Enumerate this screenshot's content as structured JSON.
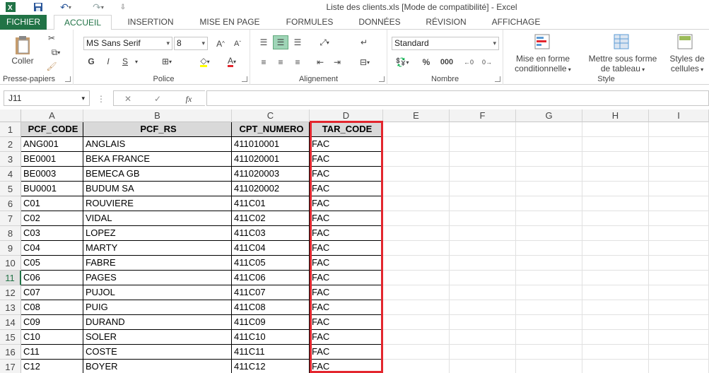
{
  "window": {
    "title": "Liste des clients.xls  [Mode de compatibilité] - Excel",
    "qat": [
      "excel-logo-icon",
      "save-icon",
      "undo-icon",
      "redo-icon"
    ]
  },
  "tabs": [
    {
      "label": "FICHIER",
      "type": "file"
    },
    {
      "label": "ACCUEIL",
      "type": "active"
    },
    {
      "label": "INSERTION",
      "type": ""
    },
    {
      "label": "MISE EN PAGE",
      "type": ""
    },
    {
      "label": "FORMULES",
      "type": ""
    },
    {
      "label": "DONNÉES",
      "type": ""
    },
    {
      "label": "RÉVISION",
      "type": ""
    },
    {
      "label": "AFFICHAGE",
      "type": ""
    }
  ],
  "ribbon": {
    "clipboard": {
      "paste_label": "Coller",
      "group_label": "Presse-papiers"
    },
    "font": {
      "font_name": "MS Sans Serif",
      "font_size": "8",
      "bold": "G",
      "italic": "I",
      "underline": "S",
      "group_label": "Police"
    },
    "alignment": {
      "group_label": "Alignement"
    },
    "number": {
      "format": "Standard",
      "percent": "%",
      "thousands": "000",
      "group_label": "Nombre"
    },
    "styles": {
      "conditional": [
        "Mise en forme",
        "conditionnelle"
      ],
      "table": [
        "Mettre sous forme",
        "de tableau"
      ],
      "cell_styles": [
        "Styles de",
        "cellules"
      ],
      "group_label": "Style"
    }
  },
  "formula_bar": {
    "name_box": "J11",
    "fx": "fx",
    "cancel": "✕",
    "enter": "✓",
    "formula": ""
  },
  "grid": {
    "columns": [
      "A",
      "B",
      "C",
      "D",
      "E",
      "F",
      "G",
      "H",
      "I"
    ],
    "header_row": [
      "PCF_CODE",
      "PCF_RS",
      "CPT_NUMERO",
      "TAR_CODE"
    ],
    "rows": [
      [
        "ANG001",
        "ANGLAIS",
        "411010001",
        "FAC"
      ],
      [
        "BE0001",
        "BEKA FRANCE",
        "411020001",
        "FAC"
      ],
      [
        "BE0003",
        "BEMECA GB",
        "411020003",
        "FAC"
      ],
      [
        "BU0001",
        "BUDUM SA",
        "411020002",
        "FAC"
      ],
      [
        "C01",
        "ROUVIERE",
        "411C01",
        "FAC"
      ],
      [
        "C02",
        "VIDAL",
        "411C02",
        "FAC"
      ],
      [
        "C03",
        "LOPEZ",
        "411C03",
        "FAC"
      ],
      [
        "C04",
        "MARTY",
        "411C04",
        "FAC"
      ],
      [
        "C05",
        "FABRE",
        "411C05",
        "FAC"
      ],
      [
        "C06",
        "PAGES",
        "411C06",
        "FAC"
      ],
      [
        "C07",
        "PUJOL",
        "411C07",
        "FAC"
      ],
      [
        "C08",
        "PUIG",
        "411C08",
        "FAC"
      ],
      [
        "C09",
        "DURAND",
        "411C09",
        "FAC"
      ],
      [
        "C10",
        "SOLER",
        "411C10",
        "FAC"
      ],
      [
        "C11",
        "COSTE",
        "411C11",
        "FAC"
      ],
      [
        "C12",
        "BOYER",
        "411C12",
        "FAC"
      ]
    ],
    "row_numbers": [
      "1",
      "2",
      "3",
      "4",
      "5",
      "6",
      "7",
      "8",
      "9",
      "10",
      "11",
      "12",
      "13",
      "14",
      "15",
      "16",
      "17"
    ],
    "active_row": "11",
    "highlight_color": "#e3262e"
  }
}
